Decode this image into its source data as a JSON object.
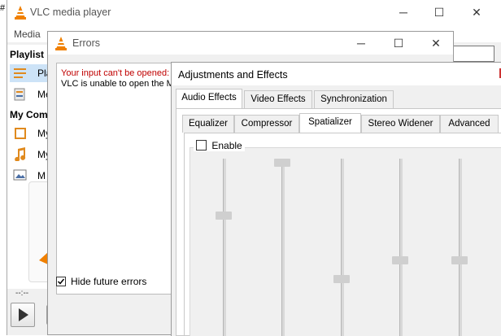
{
  "vlc": {
    "title": "VLC media player",
    "menu": "Media",
    "sidebar": {
      "playlist_header": "Playlist",
      "items": [
        {
          "label": "Play",
          "icon": "playlist-icon"
        },
        {
          "label": "Me",
          "icon": "media-library-icon"
        }
      ],
      "computer_header": "My Comp",
      "computer_items": [
        {
          "label": "My",
          "icon": "videos-icon"
        },
        {
          "label": "My",
          "icon": "music-icon"
        },
        {
          "label": "M",
          "icon": "pictures-icon"
        }
      ]
    },
    "time": "--:--"
  },
  "errors": {
    "title": "Errors",
    "error_line": "Your input can't be opened:",
    "detail_line": "VLC is unable to open the MR",
    "hide_future_label": "Hide future errors",
    "hide_future_checked": true
  },
  "adjustments": {
    "title": "Adjustments and Effects",
    "main_tabs": [
      "Audio Effects",
      "Video Effects",
      "Synchronization"
    ],
    "active_main_tab": "Audio Effects",
    "sub_tabs": [
      "Equalizer",
      "Compressor",
      "Spatializer",
      "Stereo Widener",
      "Advanced"
    ],
    "active_sub_tab": "Spatializer",
    "enable_label": "Enable",
    "enable_checked": false,
    "sliders": [
      0.34,
      0.0,
      0.75,
      0.63,
      0.63
    ]
  }
}
